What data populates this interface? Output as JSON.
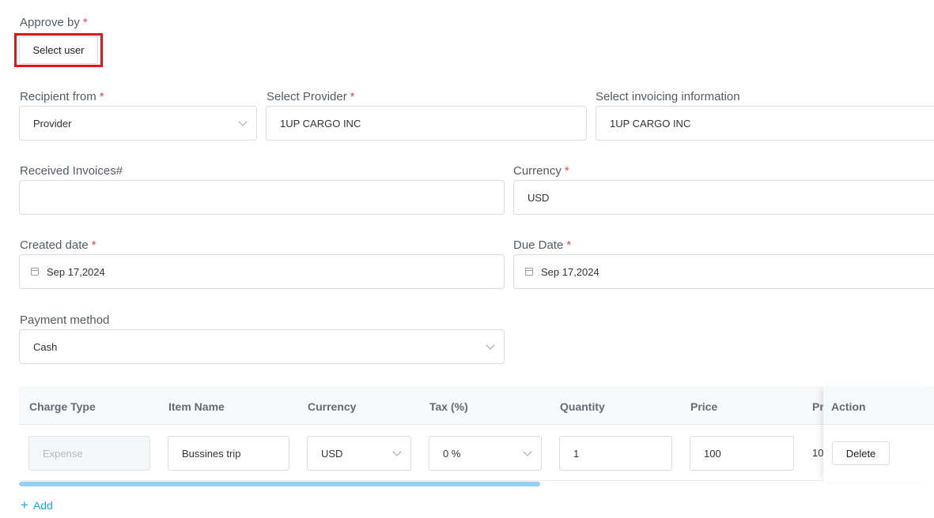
{
  "approve": {
    "label": "Approve by",
    "required": "*",
    "select_user_label": "Select user"
  },
  "recipient": {
    "label": "Recipient from",
    "required": "*",
    "value": "Provider"
  },
  "provider": {
    "label": "Select Provider",
    "required": "*",
    "value": "1UP CARGO INC"
  },
  "invoicing": {
    "label": "Select invoicing information",
    "value": "1UP CARGO INC"
  },
  "received": {
    "label": "Received Invoices#",
    "value": ""
  },
  "currency": {
    "label": "Currency",
    "required": "*",
    "value": "USD"
  },
  "created": {
    "label": "Created date",
    "required": "*",
    "value": "Sep 17,2024"
  },
  "due": {
    "label": "Due Date",
    "required": "*",
    "value": "Sep 17,2024"
  },
  "payment": {
    "label": "Payment method",
    "value": "Cash"
  },
  "table": {
    "headers": [
      "Charge Type",
      "Item Name",
      "Currency",
      "Tax (%)",
      "Quantity",
      "Price",
      "Pr",
      "Action"
    ],
    "row": {
      "charge_type": "Expense",
      "item_name": "Bussines trip",
      "currency": "USD",
      "tax": "0 %",
      "quantity": "1",
      "price": "100",
      "partial": "10",
      "delete_label": "Delete"
    }
  },
  "add": {
    "label": "Add"
  },
  "colors": {
    "highlight": "#e5131a",
    "accent": "#18a7e0",
    "scrollbar": "#8fd3f0",
    "required": "#e5484d"
  }
}
